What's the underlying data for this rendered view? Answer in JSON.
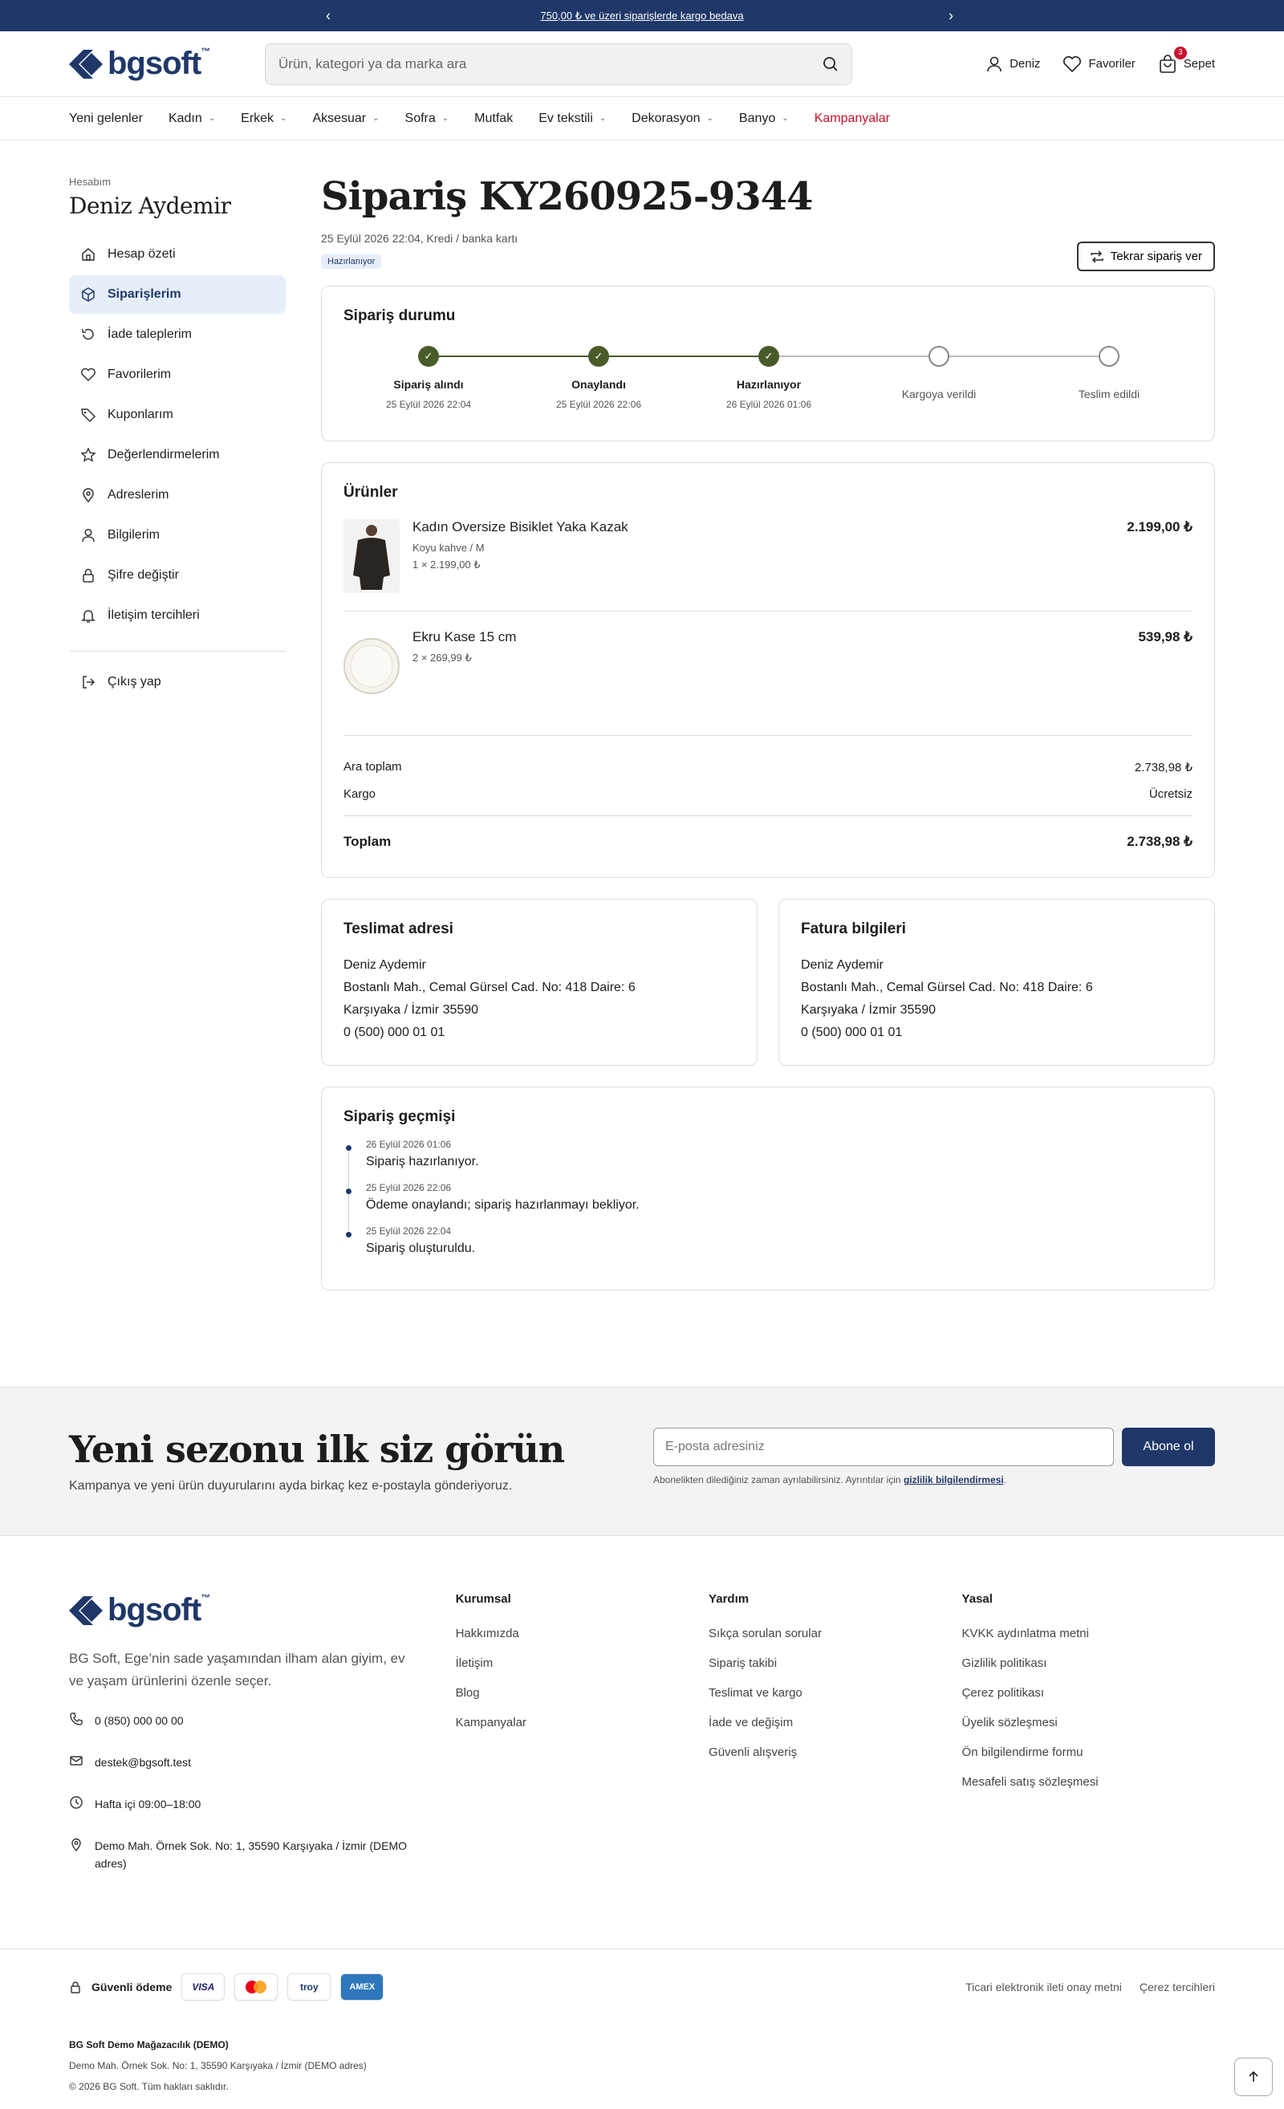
{
  "topbar": {
    "message": "750,00 ₺ ve üzeri siparişlerde kargo bedava"
  },
  "header": {
    "logo_text": "bgsoft",
    "logo_tm": "™",
    "search_placeholder": "Ürün, kategori ya da marka ara",
    "user_label": "Deniz",
    "favorites_label": "Favoriler",
    "cart_label": "Sepet",
    "cart_count": "3"
  },
  "nav": {
    "items": [
      "Yeni gelenler",
      "Kadın",
      "Erkek",
      "Aksesuar",
      "Sofra",
      "Mutfak",
      "Ev tekstili",
      "Dekorasyon",
      "Banyo",
      "Kampanyalar"
    ]
  },
  "sidebar": {
    "eyebrow": "Hesabım",
    "user_name": "Deniz Aydemir",
    "items": [
      "Hesap özeti",
      "Siparişlerim",
      "İade taleplerim",
      "Favorilerim",
      "Kuponlarım",
      "Değerlendirmelerim",
      "Adreslerim",
      "Bilgilerim",
      "Şifre değiştir",
      "İletişim tercihleri"
    ],
    "logout": "Çıkış yap"
  },
  "order": {
    "title": "Sipariş KY260925-9344",
    "meta": "25 Eylül 2026 22:04, Kredi / banka kartı",
    "status": "Hazırlanıyor",
    "reorder": "Tekrar sipariş ver"
  },
  "tracker": {
    "title": "Sipariş durumu",
    "steps": [
      {
        "label": "Sipariş alındı",
        "date": "25 Eylül 2026 22:04"
      },
      {
        "label": "Onaylandı",
        "date": "25 Eylül 2026 22:06"
      },
      {
        "label": "Hazırlanıyor",
        "date": "26 Eylül 2026 01:06"
      },
      {
        "label": "Kargoya verildi",
        "date": ""
      },
      {
        "label": "Teslim edildi",
        "date": ""
      }
    ]
  },
  "products": {
    "title": "Ürünler",
    "items": [
      {
        "name": "Kadın Oversize Bisiklet Yaka Kazak",
        "variant": "Koyu kahve / M",
        "qty": "1 × 2.199,00 ₺",
        "price": "2.199,00 ₺"
      },
      {
        "name": "Ekru Kase 15 cm",
        "variant": "",
        "qty": "2 × 269,99 ₺",
        "price": "539,98 ₺"
      }
    ],
    "subtotal_label": "Ara toplam",
    "subtotal": "2.738,98 ₺",
    "shipping_label": "Kargo",
    "shipping": "Ücretsiz",
    "total_label": "Toplam",
    "total": "2.738,98 ₺"
  },
  "delivery": {
    "title": "Teslimat adresi",
    "name": "Deniz Aydemir",
    "line1": "Bostanlı Mah., Cemal Gürsel Cad. No: 418 Daire: 6",
    "line2": "Karşıyaka / İzmir 35590",
    "phone": "0 (500) 000 01 01"
  },
  "billing": {
    "title": "Fatura bilgileri",
    "name": "Deniz Aydemir",
    "line1": "Bostanlı Mah., Cemal Gürsel Cad. No: 418 Daire: 6",
    "line2": "Karşıyaka / İzmir 35590",
    "phone": "0 (500) 000 01 01"
  },
  "history": {
    "title": "Sipariş geçmişi",
    "items": [
      {
        "date": "26 Eylül 2026 01:06",
        "text": "Sipariş hazırlanıyor."
      },
      {
        "date": "25 Eylül 2026 22:06",
        "text": "Ödeme onaylandı; sipariş hazırlanmayı bekliyor."
      },
      {
        "date": "25 Eylül 2026 22:04",
        "text": "Sipariş oluşturuldu."
      }
    ]
  },
  "newsletter": {
    "title": "Yeni sezonu ilk siz görün",
    "desc": "Kampanya ve yeni ürün duyurularını ayda birkaç kez e-postayla gönderiyoruz.",
    "placeholder": "E-posta adresiniz",
    "button": "Abone ol",
    "note": "Abonelikten dilediğiniz zaman ayrılabilirsiniz. Ayrıntılar için",
    "note_link": "gizlilik bilgilendirmesi",
    "note_end": "."
  },
  "footer": {
    "about": "BG Soft, Ege’nin sade yaşamından ilham alan giyim, ev ve yaşam ürünlerini özenle seçer.",
    "phone": "0 (850) 000 00 00",
    "email": "destek@bgsoft.test",
    "hours": "Hafta içi 09:00–18:00",
    "address": "Demo Mah. Örnek Sok. No: 1, 35590 Karşıyaka / İzmir (DEMO adres)",
    "cols": [
      {
        "title": "Kurumsal",
        "links": [
          "Hakkımızda",
          "İletişim",
          "Blog",
          "Kampanyalar"
        ]
      },
      {
        "title": "Yardım",
        "links": [
          "Sıkça sorulan sorular",
          "Sipariş takibi",
          "Teslimat ve kargo",
          "İade ve değişim",
          "Güvenli alışveriş"
        ]
      },
      {
        "title": "Yasal",
        "links": [
          "KVKK aydınlatma metni",
          "Gizlilik politikası",
          "Çerez politikası",
          "Üyelik sözleşmesi",
          "Ön bilgilendirme formu",
          "Mesafeli satış sözleşmesi"
        ]
      }
    ],
    "secure_label": "Güvenli ödeme",
    "payments": [
      "VISA",
      "Mastercard",
      "troy",
      "AMEX"
    ],
    "bottom_links": [
      "Ticari elektronik ileti onay metni",
      "Çerez tercihleri"
    ],
    "company": "BG Soft Demo Mağazacılık (DEMO)",
    "company_address": "Demo Mah. Örnek Sok. No: 1, 35590 Karşıyaka / İzmir (DEMO adres)",
    "copyright": "© 2026 BG Soft. Tüm hakları saklıdır."
  },
  "colors": {
    "brand": "#1f3869",
    "accent": "#c8102e",
    "success": "#4a5b2a"
  }
}
